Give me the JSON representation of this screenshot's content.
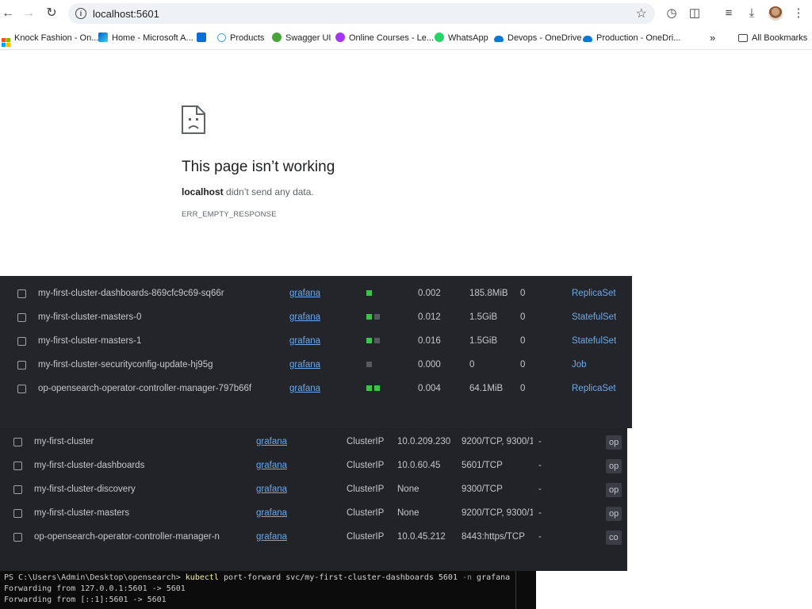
{
  "browser": {
    "url": "localhost:5601",
    "all_bookmarks_label": "All Bookmarks",
    "bookmarks": [
      {
        "label": "Knock Fashion - On...",
        "icon": "microsoft-logo-icon"
      },
      {
        "label": "Home - Microsoft A...",
        "icon": "azure-icon"
      },
      {
        "label": "",
        "icon": "azure-devops-icon"
      },
      {
        "label": "Products",
        "icon": "products-icon"
      },
      {
        "label": "Swagger UI",
        "icon": "swagger-icon"
      },
      {
        "label": "Online Courses - Le...",
        "icon": "udemy-icon"
      },
      {
        "label": "WhatsApp",
        "icon": "whatsapp-icon"
      },
      {
        "label": "Devops - OneDrive",
        "icon": "onedrive-icon"
      },
      {
        "label": "Production - OneDri...",
        "icon": "onedrive-icon"
      }
    ]
  },
  "error": {
    "title": "This page isn’t working",
    "host": "localhost",
    "message": " didn’t send any data.",
    "code": "ERR_EMPTY_RESPONSE"
  },
  "pods": [
    {
      "name": "my-first-cluster-dashboards-869cfc9c69-sq66r",
      "namespace": "grafana",
      "containers": [
        "green"
      ],
      "cpu": "0.002",
      "memory": "185.8MiB",
      "restarts": "0",
      "controlled_by": "ReplicaSet"
    },
    {
      "name": "my-first-cluster-masters-0",
      "namespace": "grafana",
      "containers": [
        "green",
        "grey"
      ],
      "cpu": "0.012",
      "memory": "1.5GiB",
      "restarts": "0",
      "controlled_by": "StatefulSet"
    },
    {
      "name": "my-first-cluster-masters-1",
      "namespace": "grafana",
      "containers": [
        "green",
        "grey"
      ],
      "cpu": "0.016",
      "memory": "1.5GiB",
      "restarts": "0",
      "controlled_by": "StatefulSet"
    },
    {
      "name": "my-first-cluster-securityconfig-update-hj95g",
      "namespace": "grafana",
      "containers": [
        "grey"
      ],
      "cpu": "0.000",
      "memory": "0",
      "restarts": "0",
      "controlled_by": "Job"
    },
    {
      "name": "op-opensearch-operator-controller-manager-797b66f",
      "namespace": "grafana",
      "containers": [
        "green",
        "green"
      ],
      "cpu": "0.004",
      "memory": "64.1MiB",
      "restarts": "0",
      "controlled_by": "ReplicaSet"
    }
  ],
  "services": [
    {
      "name": "my-first-cluster",
      "namespace": "grafana",
      "type": "ClusterIP",
      "cluster_ip": "10.0.209.230",
      "ports": "9200/TCP, 9300/1",
      "external_ip": "-",
      "selector": "op"
    },
    {
      "name": "my-first-cluster-dashboards",
      "namespace": "grafana",
      "type": "ClusterIP",
      "cluster_ip": "10.0.60.45",
      "ports": "5601/TCP",
      "external_ip": "-",
      "selector": "op"
    },
    {
      "name": "my-first-cluster-discovery",
      "namespace": "grafana",
      "type": "ClusterIP",
      "cluster_ip": "None",
      "ports": "9300/TCP",
      "external_ip": "-",
      "selector": "op"
    },
    {
      "name": "my-first-cluster-masters",
      "namespace": "grafana",
      "type": "ClusterIP",
      "cluster_ip": "None",
      "ports": "9200/TCP, 9300/1",
      "external_ip": "-",
      "selector": "op"
    },
    {
      "name": "op-opensearch-operator-controller-manager-n",
      "namespace": "grafana",
      "type": "ClusterIP",
      "cluster_ip": "10.0.45.212",
      "ports": "8443:https/TCP",
      "external_ip": "-",
      "selector": "co"
    }
  ],
  "terminal": {
    "prompt": "PS C:\\Users\\Admin\\Desktop\\opensearch> ",
    "command": "kubectl",
    "args": " port-forward svc/my-first-cluster-dashboards 5601 ",
    "flag": "-n",
    "namespace_arg": " grafana",
    "output_1": "Forwarding from 127.0.0.1:5601 -> 5601",
    "output_2": "Forwarding from [::1]:5601 -> 5601"
  }
}
